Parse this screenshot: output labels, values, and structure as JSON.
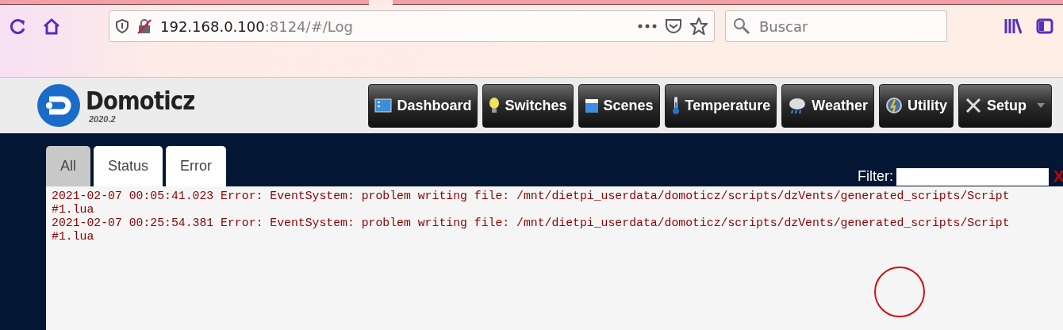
{
  "browser": {
    "tabs": [
      {
        "selected": false
      },
      {
        "selected": true
      },
      {
        "selected": false
      }
    ],
    "url_host": "192.168.0.100",
    "url_rest": ":8124/#/Log",
    "search": {
      "placeholder": "Buscar"
    }
  },
  "app": {
    "name": "Domoticz",
    "version": "2020.2"
  },
  "nav": [
    {
      "label": "Dashboard",
      "kind": "dashboard",
      "dropdown": false
    },
    {
      "label": "Switches",
      "kind": "bulb",
      "dropdown": false
    },
    {
      "label": "Scenes",
      "kind": "clapper",
      "dropdown": false
    },
    {
      "label": "Temperature",
      "kind": "thermometer",
      "dropdown": false
    },
    {
      "label": "Weather",
      "kind": "cloud",
      "dropdown": false
    },
    {
      "label": "Utility",
      "kind": "gauge",
      "dropdown": false
    },
    {
      "label": "Setup",
      "kind": "tools",
      "dropdown": true
    }
  ],
  "tabs": [
    {
      "label": "All",
      "selected": true
    },
    {
      "label": "Status",
      "selected": false
    },
    {
      "label": "Error",
      "selected": false
    }
  ],
  "filter": {
    "label": "Filter:",
    "clear": "X"
  },
  "log": [
    {
      "text": "2021-02-07 00:05:41.023 Error: EventSystem: problem writing file: /mnt/dietpi_userdata/domoticz/scripts/dzVents/generated_scripts/Script #1.lua"
    },
    {
      "text": "2021-02-07 00:25:54.381 Error: EventSystem: problem writing file: /mnt/dietpi_userdata/domoticz/scripts/dzVents/generated_scripts/Script #1.lua"
    }
  ]
}
